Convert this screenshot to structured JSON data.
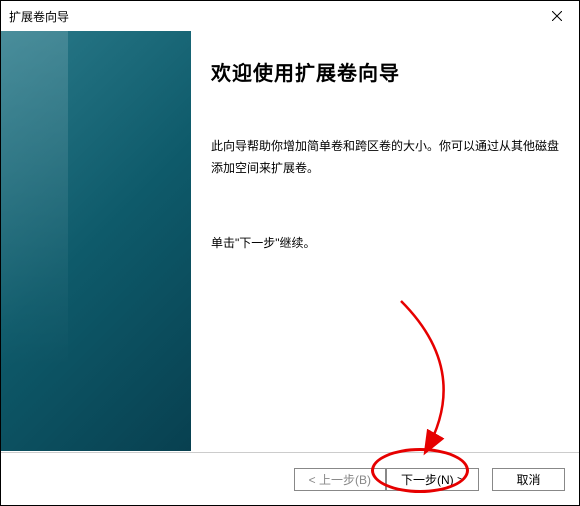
{
  "titlebar": {
    "title": "扩展卷向导"
  },
  "main": {
    "heading": "欢迎使用扩展卷向导",
    "description": "此向导帮助你增加简单卷和跨区卷的大小。你可以通过从其他磁盘添加空间来扩展卷。",
    "instruction": "单击\"下一步\"继续。"
  },
  "footer": {
    "back_label": "< 上一步(B)",
    "next_label": "下一步(N) >",
    "cancel_label": "取消"
  }
}
